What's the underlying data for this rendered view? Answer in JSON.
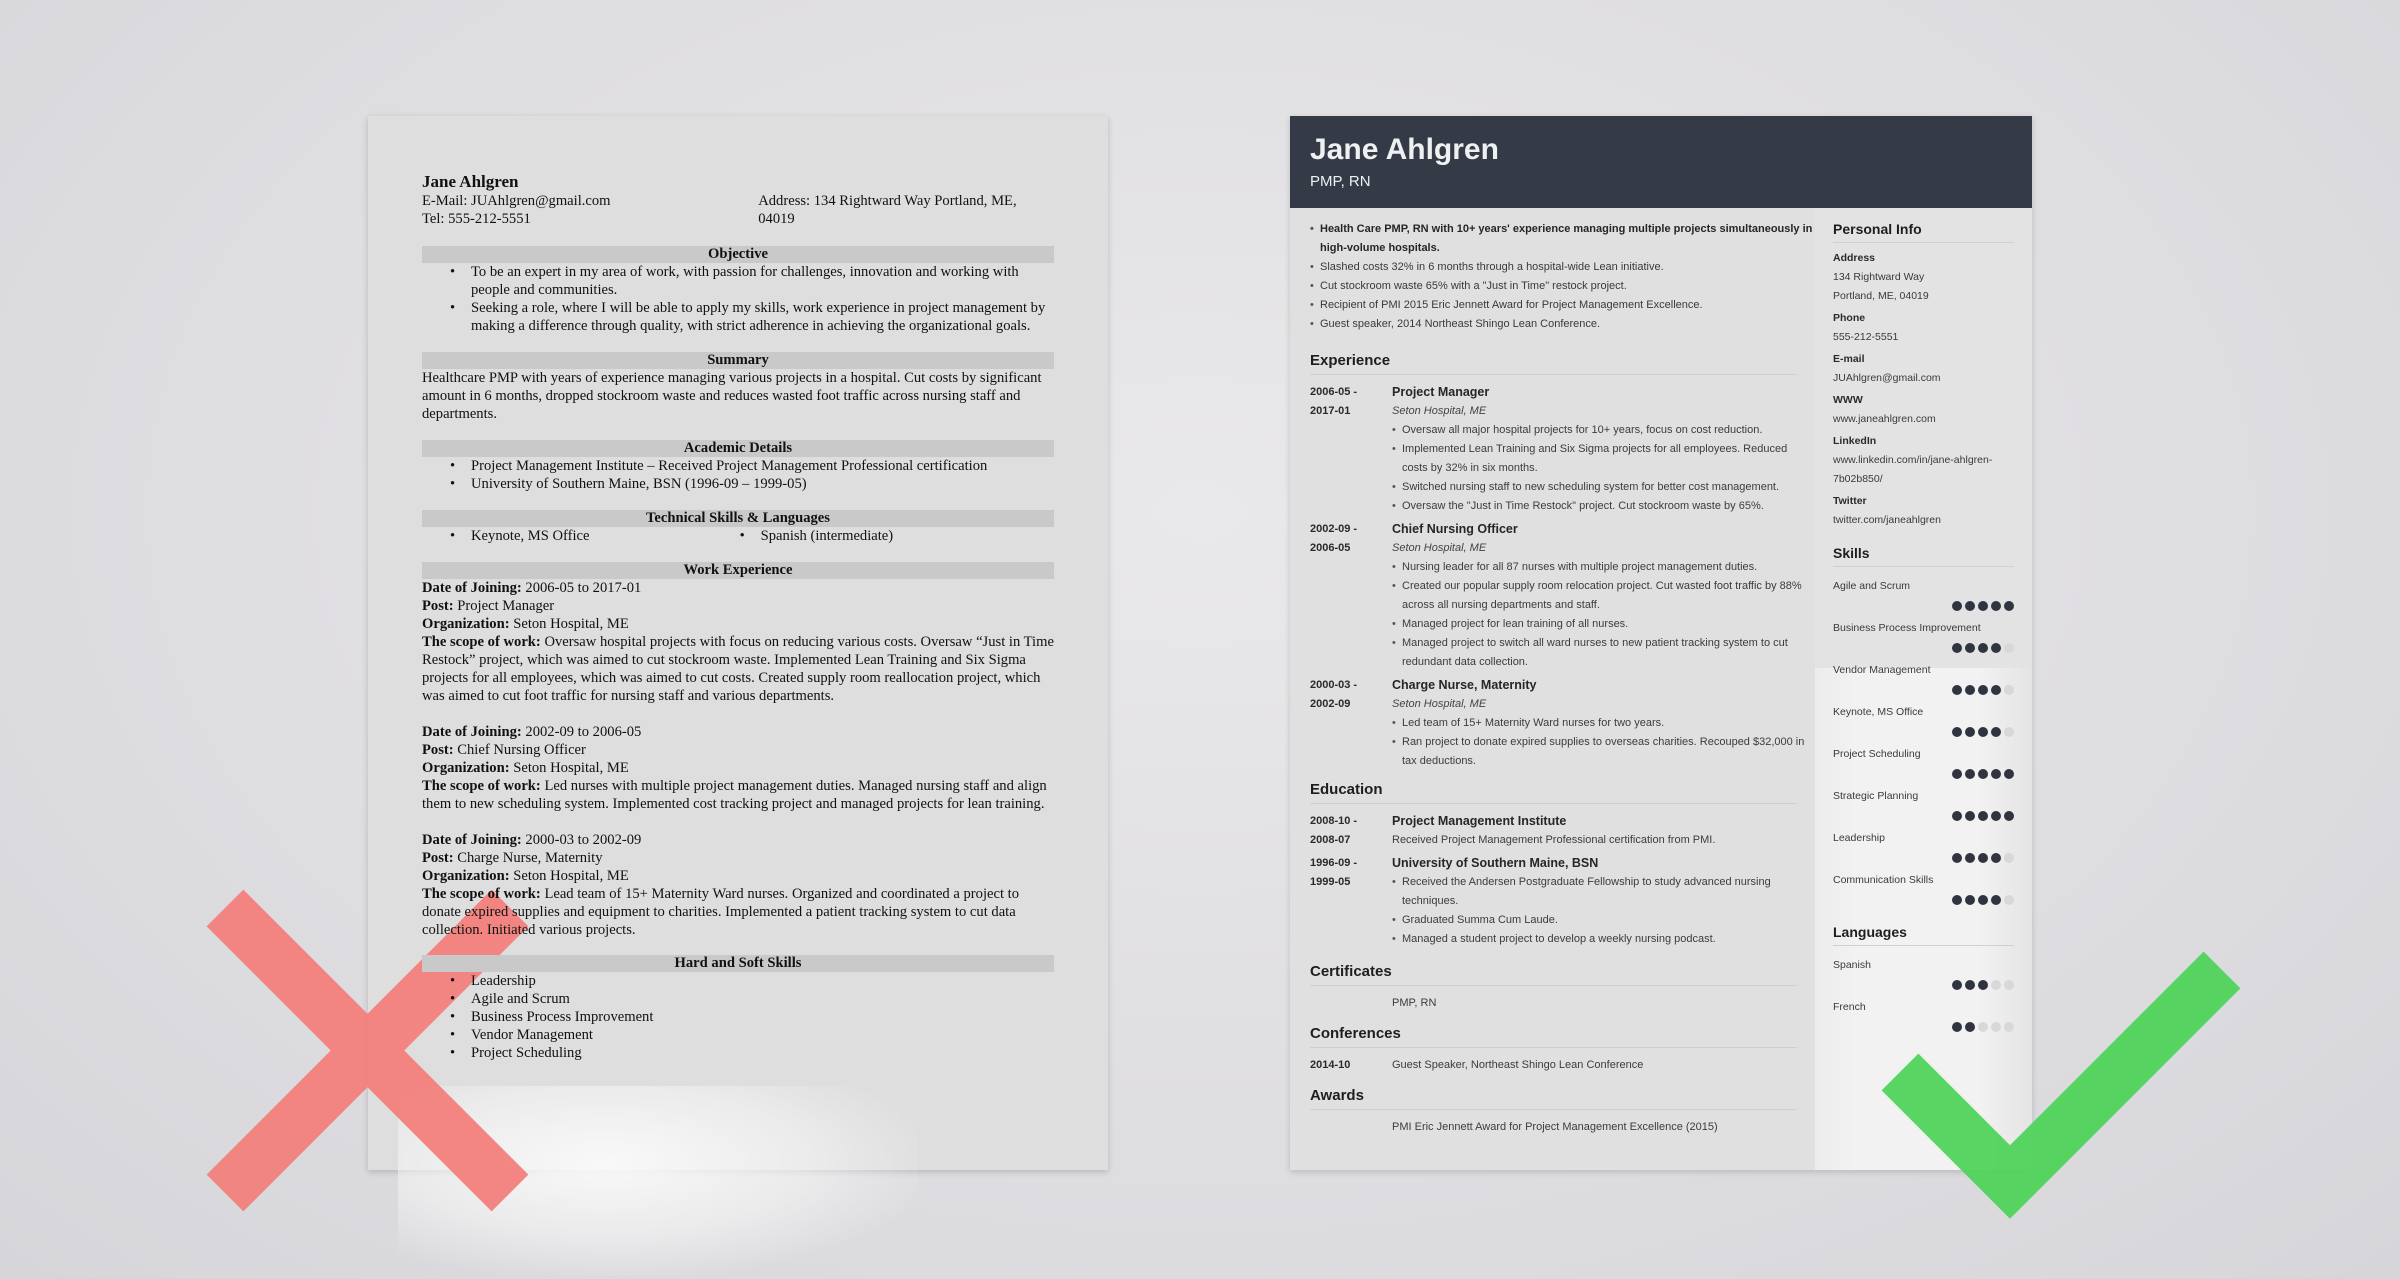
{
  "bad_resume": {
    "name": "Jane Ahlgren",
    "email": "E-Mail: JUAhlgren@gmail.com",
    "tel": "Tel: 555-212-5551",
    "address_line1": "Address: 134 Rightward Way Portland, ME,",
    "address_line2": "04019",
    "sections": {
      "objective": "Objective",
      "summary": "Summary",
      "academic": "Academic Details",
      "technical": "Technical Skills & Languages",
      "work": "Work Experience",
      "skills": "Hard and Soft Skills"
    },
    "objective_items": [
      "To be an expert in my area of work, with passion for challenges, innovation and working with people and communities.",
      "Seeking a role, where I will be able to apply my skills, work experience in project management by making a difference through quality, with strict adherence in achieving the organizational goals."
    ],
    "summary_text": "Healthcare PMP with years of experience managing various projects in a hospital. Cut costs by significant amount in 6 months, dropped stockroom waste and reduces wasted foot traffic across nursing staff and departments.",
    "academic_items": [
      "Project Management Institute – Received Project Management Professional certification",
      "University of Southern Maine, BSN (1996-09 – 1999-05)"
    ],
    "technical_items": [
      "Keynote, MS Office",
      "Spanish (intermediate)"
    ],
    "labels": {
      "date": "Date of Joining:",
      "post": "Post:",
      "org": "Organization:",
      "scope": "The scope of work:"
    },
    "jobs": [
      {
        "date": "2006-05 to 2017-01",
        "post": "Project Manager",
        "org": "Seton Hospital, ME",
        "scope": "Oversaw hospital projects with focus on reducing various costs. Oversaw “Just in Time Restock” project, which was aimed to cut stockroom waste. Implemented Lean Training and Six Sigma projects for all employees, which was aimed to cut costs. Created supply room reallocation project, which was aimed to cut foot traffic for nursing staff and various departments."
      },
      {
        "date": "2002-09 to 2006-05",
        "post": "Chief Nursing Officer",
        "org": "Seton Hospital, ME",
        "scope": "Led nurses with multiple project management duties. Managed nursing staff and align them to new scheduling system. Implemented cost tracking project and managed projects for lean training."
      },
      {
        "date": "2000-03 to 2002-09",
        "post": "Charge Nurse, Maternity",
        "org": "Seton Hospital, ME",
        "scope": "Lead team of 15+ Maternity Ward nurses. Organized and coordinated a project to donate expired supplies and equipment to charities. Implemented a patient tracking system to cut data collection. Initiated various projects."
      }
    ],
    "skills": [
      "Leadership",
      "Agile and Scrum",
      "Business Process Improvement",
      "Vendor Management",
      "Project Scheduling"
    ]
  },
  "good_resume": {
    "name": "Jane Ahlgren",
    "title": "PMP, RN",
    "summary": [
      "Health Care PMP, RN with 10+ years' experience managing multiple projects simultaneously in high-volume hospitals.",
      "Slashed costs 32% in 6 months through a hospital-wide Lean initiative.",
      "Cut stockroom waste 65% with a \"Just in Time\" restock project.",
      "Recipient of PMI 2015 Eric Jennett Award for Project Management Excellence.",
      "Guest speaker, 2014 Northeast Shingo Lean Conference."
    ],
    "sections": {
      "experience": "Experience",
      "education": "Education",
      "certificates": "Certificates",
      "conferences": "Conferences",
      "awards": "Awards",
      "personal_info": "Personal Info",
      "skills": "Skills",
      "languages": "Languages"
    },
    "experience": [
      {
        "date_from": "2006-05 -",
        "date_to": "2017-01",
        "role": "Project Manager",
        "org": "Seton Hospital, ME",
        "bullets": [
          "Oversaw all major hospital projects for 10+ years, focus on cost reduction.",
          "Implemented Lean Training and Six Sigma projects for all employees. Reduced costs by 32% in six months.",
          "Switched nursing staff to new scheduling system for better cost management.",
          "Oversaw the \"Just in Time Restock\" project. Cut stockroom waste by 65%."
        ]
      },
      {
        "date_from": "2002-09 -",
        "date_to": "2006-05",
        "role": "Chief Nursing Officer",
        "org": "Seton Hospital, ME",
        "bullets": [
          "Nursing leader for all 87 nurses with multiple project management duties.",
          "Created our popular supply room relocation project. Cut wasted foot traffic by 88% across all nursing departments and staff.",
          "Managed project for lean training of all nurses.",
          "Managed project to switch all ward nurses to new patient tracking system to cut redundant data collection."
        ]
      },
      {
        "date_from": "2000-03 -",
        "date_to": "2002-09",
        "role": "Charge Nurse, Maternity",
        "org": "Seton Hospital, ME",
        "bullets": [
          "Led team of 15+ Maternity Ward nurses for two years.",
          "Ran project to donate expired supplies to overseas charities. Recouped $32,000 in tax deductions."
        ]
      }
    ],
    "education": [
      {
        "date_from": "2008-10 -",
        "date_to": "2008-07",
        "school": "Project Management Institute",
        "desc": "Received Project Management Professional certification from PMI."
      },
      {
        "date_from": "1996-09 -",
        "date_to": "1999-05",
        "school": "University of Southern Maine, BSN",
        "bullets": [
          "Received the Andersen Postgraduate Fellowship to study advanced nursing techniques.",
          "Graduated Summa Cum Laude.",
          "Managed a student project to develop a weekly nursing podcast."
        ]
      }
    ],
    "certificates": {
      "date": "",
      "text": "PMP, RN"
    },
    "conferences": {
      "date": "2014-10",
      "text": "Guest Speaker, Northeast Shingo Lean Conference"
    },
    "awards": {
      "date": "",
      "text": "PMI Eric Jennett Award for Project Management Excellence (2015)"
    },
    "personal_info": [
      {
        "label": "Address",
        "lines": [
          "134 Rightward Way",
          "Portland, ME, 04019"
        ]
      },
      {
        "label": "Phone",
        "lines": [
          "555-212-5551"
        ]
      },
      {
        "label": "E-mail",
        "lines": [
          "JUAhlgren@gmail.com"
        ]
      },
      {
        "label": "WWW",
        "lines": [
          "www.janeahlgren.com"
        ]
      },
      {
        "label": "LinkedIn",
        "lines": [
          "www.linkedin.com/in/jane-ahlgren-",
          "7b02b850/"
        ]
      },
      {
        "label": "Twitter",
        "lines": [
          "twitter.com/janeahlgren"
        ]
      }
    ],
    "skills": [
      {
        "name": "Agile and Scrum",
        "level": 5,
        "max": 5
      },
      {
        "name": "Business Process Improvement",
        "level": 4,
        "max": 5
      },
      {
        "name": "Vendor Management",
        "level": 4,
        "max": 5
      },
      {
        "name": "Keynote, MS Office",
        "level": 4,
        "max": 5
      },
      {
        "name": "Project Scheduling",
        "level": 5,
        "max": 5
      },
      {
        "name": "Strategic Planning",
        "level": 5,
        "max": 5
      },
      {
        "name": "Leadership",
        "level": 4,
        "max": 5
      },
      {
        "name": "Communication Skills",
        "level": 4,
        "max": 5
      }
    ],
    "languages": [
      {
        "name": "Spanish",
        "level": 3,
        "max": 5
      },
      {
        "name": "French",
        "level": 2,
        "max": 5
      }
    ]
  },
  "marks": {
    "bad": {
      "icon": "cross-icon",
      "color": "#f47e7a"
    },
    "good": {
      "icon": "checkmark-icon",
      "color": "#4fd35a"
    }
  },
  "colors": {
    "header_bg": "#343a46",
    "dot_on": "#2f3440",
    "dot_off": "#d8d8d8"
  }
}
